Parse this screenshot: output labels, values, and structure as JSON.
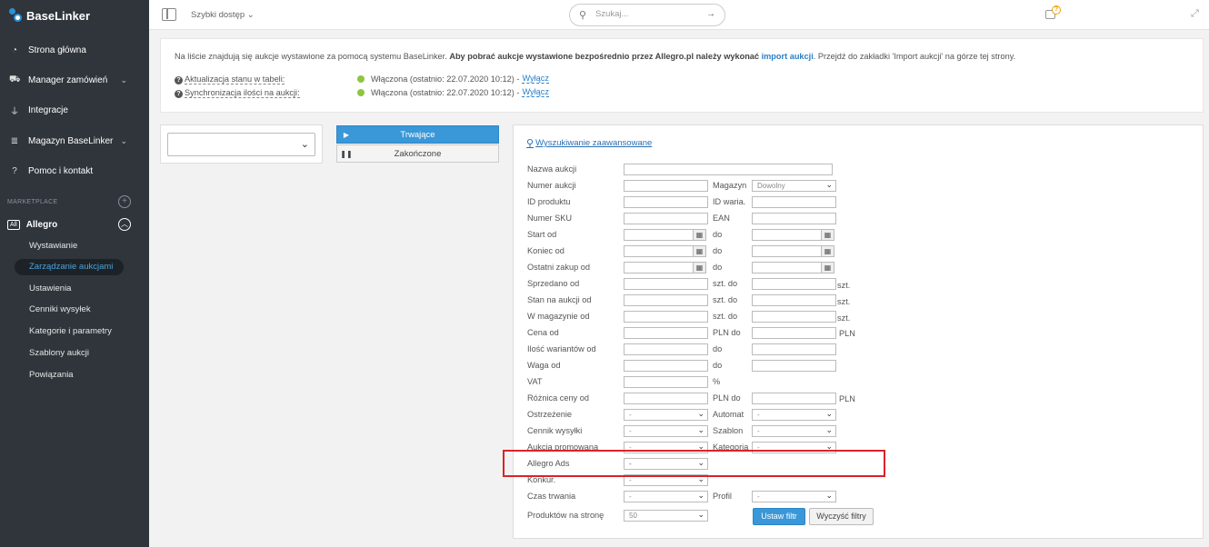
{
  "app": {
    "name": "BaseLinker"
  },
  "sidebar": {
    "items": [
      {
        "label": "Strona główna",
        "icon": "speedometer-icon"
      },
      {
        "label": "Manager zamówień",
        "icon": "cart-icon"
      },
      {
        "label": "Integracje",
        "icon": "plug-icon"
      },
      {
        "label": "Magazyn BaseLinker",
        "icon": "database-icon"
      },
      {
        "label": "Pomoc i kontakt",
        "icon": "help-circle-icon"
      }
    ],
    "section": "MARKETPLACE",
    "allegro": {
      "badge": "All",
      "label": "Allegro"
    },
    "subitems": [
      {
        "label": "Wystawianie"
      },
      {
        "label": "Zarządzanie aukcjami"
      },
      {
        "label": "Ustawienia"
      },
      {
        "label": "Cenniki wysyłek"
      },
      {
        "label": "Kategorie i parametry"
      },
      {
        "label": "Szablony aukcji"
      },
      {
        "label": "Powiązania"
      }
    ]
  },
  "topbar": {
    "quick_access": "Szybki dostęp",
    "search_placeholder": "Szukaj..."
  },
  "info": {
    "msg_pre": "Na liście znajdują się aukcje wystawione za pomocą systemu BaseLinker. ",
    "msg_bold": "Aby pobrać aukcje wystawione bezpośrednio przez Allegro.pl należy wykonać ",
    "msg_link": "import aukcji",
    "msg_post": ". Przejdź do zakładki 'Import aukcji' na górze tej strony.",
    "rows": [
      {
        "label": "Aktualizacja stanu w tabeli:",
        "value": "Włączona (ostatnio: 22.07.2020 10:12) -",
        "action": "Wyłącz"
      },
      {
        "label": "Synchronizacja ilości na aukcji:",
        "value": "Włączona (ostatnio: 22.07.2020 10:12) -",
        "action": "Wyłącz"
      }
    ]
  },
  "tabs": {
    "active": "Trwające",
    "inactive": "Zakończone"
  },
  "filters": {
    "advanced_link": "Wyszukiwanie zaawansowane",
    "labels": {
      "nazwa": "Nazwa aukcji",
      "numer": "Numer aukcji",
      "magazyn": "Magazyn",
      "id_produktu": "ID produktu",
      "id_waria": "ID waria.",
      "sku": "Numer SKU",
      "ean": "EAN",
      "start_od": "Start od",
      "koniec_od": "Koniec od",
      "ostatni_zakup": "Ostatni zakup od",
      "sprzedano": "Sprzedano od",
      "stan_aukcji": "Stan na aukcji od",
      "w_magazynie": "W magazynie od",
      "cena_od": "Cena od",
      "ilosc_wariantow": "Ilość wariantów od",
      "waga_od": "Waga od",
      "vat": "VAT",
      "roznica_ceny": "Różnica ceny od",
      "ostrzezenie": "Ostrzeżenie",
      "automat": "Automat",
      "cennik": "Cennik wysyłki",
      "szablon": "Szablon",
      "aukcja_promowana": "Aukcja promowana",
      "kategoria": "Kategoria",
      "allegro_ads": "Allegro Ads",
      "konkur": "Konkur.",
      "czas_trwania": "Czas trwania",
      "profil": "Profil",
      "produktow": "Produktów na stronę"
    },
    "do": "do",
    "szt_do": "szt. do",
    "szt": "szt.",
    "pln_do": "PLN do",
    "pln": "PLN",
    "percent": "%",
    "magazyn_value": "Dowolny",
    "dash": "-",
    "per_page": "50",
    "apply": "Ustaw filtr",
    "clear": "Wyczyść filtry"
  },
  "colors": {
    "sidebar": "#2f353b",
    "accent": "#3a97d8",
    "highlight": "#d9232a",
    "status": "#8cc63f"
  }
}
